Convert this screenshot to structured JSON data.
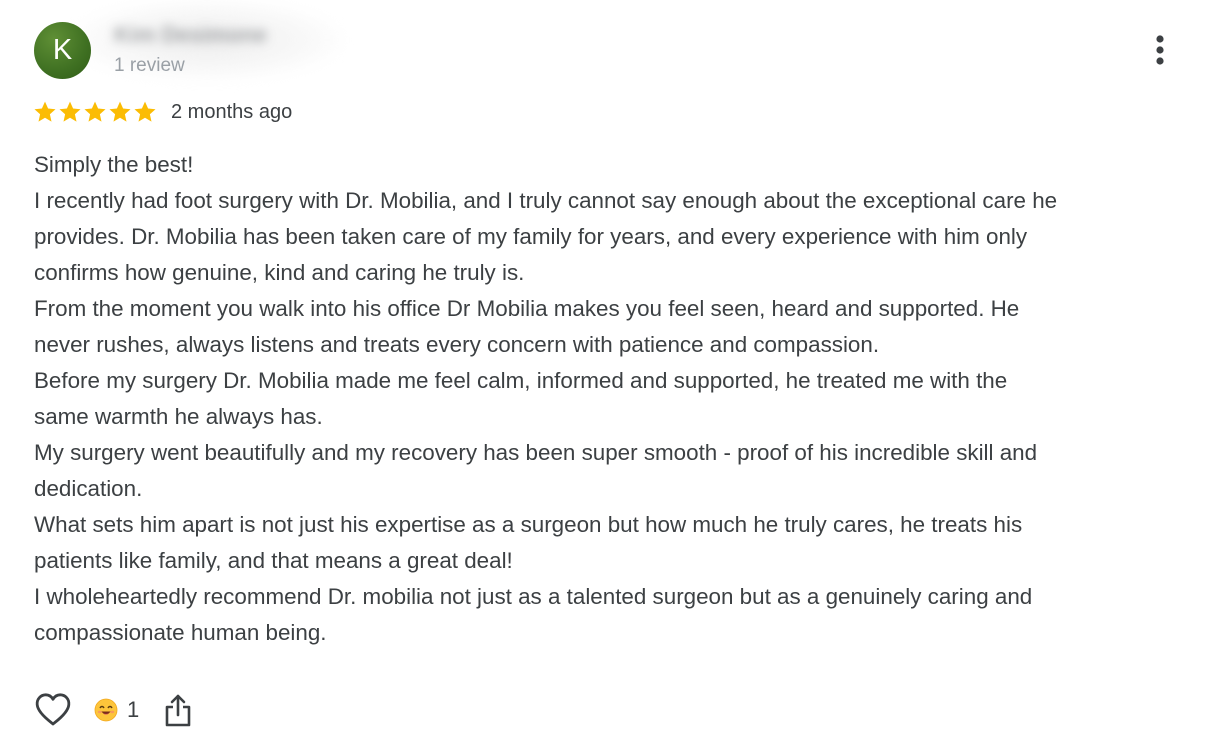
{
  "reviewer": {
    "initial": "K",
    "name": "Kim Desimone",
    "review_count": "1 review",
    "avatar_color": "#3f7022"
  },
  "rating": {
    "stars": 5,
    "max_stars": 5,
    "star_color": "#fbbc04",
    "date": "2 months ago"
  },
  "review": {
    "lines": [
      "Simply the best!",
      "I recently had foot surgery with Dr. Mobilia, and I truly cannot say enough about the exceptional care he",
      "provides. Dr. Mobilia has been taken care of my family for years, and every experience with him only",
      "confirms how genuine, kind and caring he truly is.",
      "From the moment you walk into his office Dr Mobilia makes you feel seen, heard and supported. He",
      "never rushes, always listens and treats every concern with patience and compassion.",
      "Before my surgery Dr. Mobilia made me feel calm, informed and supported, he treated me with the",
      "same warmth he always has.",
      "My surgery went beautifully and my recovery has been super smooth - proof of his incredible skill and",
      "dedication.",
      "What sets him apart is not just his expertise as a surgeon but how much he truly cares, he treats his",
      "patients like family, and that means a great deal!",
      "I wholeheartedly recommend Dr. mobilia not just as a talented surgeon but as a genuinely caring and",
      "compassionate human being."
    ]
  },
  "actions": {
    "like_icon": "heart-outline-icon",
    "reaction_icon": "smiling-face-emoji-icon",
    "reaction_count": "1",
    "share_icon": "share-icon",
    "menu_icon": "more-vertical-icon"
  }
}
